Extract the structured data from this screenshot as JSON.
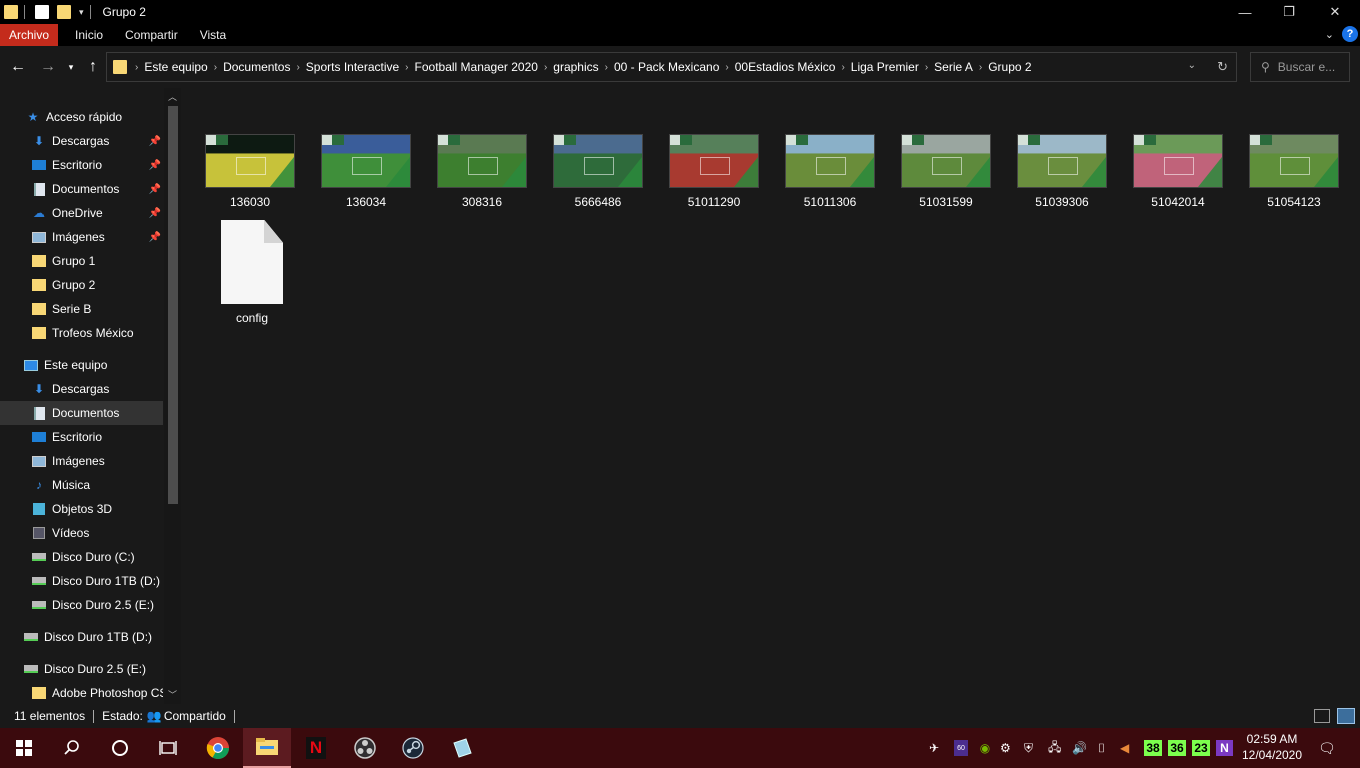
{
  "window": {
    "title": "Grupo 2",
    "minimize": "—",
    "maximize": "❐",
    "close": "✕"
  },
  "ribbon": {
    "tabs": [
      "Archivo",
      "Inicio",
      "Compartir",
      "Vista"
    ],
    "active_tab": "Archivo",
    "help": "?"
  },
  "address": {
    "crumbs": [
      "Este equipo",
      "Documentos",
      "Sports Interactive",
      "Football Manager 2020",
      "graphics",
      "00 - Pack Mexicano",
      "00Estadios México",
      "Liga Premier",
      "Serie A",
      "Grupo 2"
    ],
    "search_placeholder": "Buscar e..."
  },
  "sidebar": {
    "quick_access": {
      "label": "Acceso rápido"
    },
    "quick_items": [
      {
        "label": "Descargas",
        "icon": "download-icon",
        "pinned": true
      },
      {
        "label": "Escritorio",
        "icon": "desktop-icon",
        "pinned": true
      },
      {
        "label": "Documentos",
        "icon": "documents-icon",
        "pinned": true
      },
      {
        "label": "OneDrive",
        "icon": "onedrive-icon",
        "pinned": true
      },
      {
        "label": "Imágenes",
        "icon": "pictures-icon",
        "pinned": true
      },
      {
        "label": "Grupo 1",
        "icon": "folder-icon"
      },
      {
        "label": "Grupo 2",
        "icon": "folder-icon"
      },
      {
        "label": "Serie B",
        "icon": "folder-icon"
      },
      {
        "label": "Trofeos México",
        "icon": "folder-icon"
      }
    ],
    "this_pc": {
      "label": "Este equipo"
    },
    "pc_items": [
      {
        "label": "Descargas",
        "icon": "download-icon"
      },
      {
        "label": "Documentos",
        "icon": "documents-icon",
        "selected": true
      },
      {
        "label": "Escritorio",
        "icon": "desktop-icon"
      },
      {
        "label": "Imágenes",
        "icon": "pictures-icon"
      },
      {
        "label": "Música",
        "icon": "music-icon"
      },
      {
        "label": "Objetos 3D",
        "icon": "3d-objects-icon"
      },
      {
        "label": "Vídeos",
        "icon": "videos-icon"
      },
      {
        "label": "Disco Duro (C:)",
        "icon": "drive-icon"
      },
      {
        "label": "Disco Duro 1TB (D:)",
        "icon": "drive-icon"
      },
      {
        "label": "Disco Duro 2.5 (E:)",
        "icon": "drive-icon"
      }
    ],
    "drives": [
      {
        "label": "Disco Duro 1TB (D:)",
        "icon": "drive-icon"
      },
      {
        "label": "Disco Duro 2.5 (E:)",
        "icon": "drive-icon"
      }
    ],
    "last_item": {
      "label": "Adobe Photoshop CS",
      "icon": "folder-icon"
    }
  },
  "files": [
    {
      "name": "136030",
      "kind": "image",
      "pitch": "#c7c23a",
      "sky": "#0d1a12"
    },
    {
      "name": "136034",
      "kind": "image",
      "pitch": "#3f8f3a",
      "sky": "#3a5d9a"
    },
    {
      "name": "308316",
      "kind": "image",
      "pitch": "#3d7f2f",
      "sky": "#5a7a52"
    },
    {
      "name": "5666486",
      "kind": "image",
      "pitch": "#2e6b3a",
      "sky": "#4b6b8f"
    },
    {
      "name": "51011290",
      "kind": "image",
      "pitch": "#a83a30",
      "sky": "#56805a"
    },
    {
      "name": "51011306",
      "kind": "image",
      "pitch": "#6a8d3a",
      "sky": "#8ab0c8"
    },
    {
      "name": "51031599",
      "kind": "image",
      "pitch": "#5e8a3c",
      "sky": "#9aa6a0"
    },
    {
      "name": "51039306",
      "kind": "image",
      "pitch": "#6a8e3e",
      "sky": "#9cb8c8"
    },
    {
      "name": "51042014",
      "kind": "image",
      "pitch": "#c0637a",
      "sky": "#6b9a58"
    },
    {
      "name": "51054123",
      "kind": "image",
      "pitch": "#5f8f3a",
      "sky": "#6e8a60"
    },
    {
      "name": "config",
      "kind": "document"
    }
  ],
  "status": {
    "count": "11 elementos",
    "state_label": "Estado:",
    "state_value": "Compartido"
  },
  "taskbar": {
    "apps": [
      "start-icon",
      "search-icon",
      "cortana-icon",
      "task-view-icon",
      "chrome-icon",
      "file-explorer-icon",
      "netflix-icon",
      "obs-icon",
      "steam-icon",
      "notes-icon"
    ],
    "temps": [
      "38",
      "36",
      "23"
    ],
    "onenote": "N",
    "time": "02:59 AM",
    "date": "12/04/2020"
  },
  "colors": {
    "accent": "#c42b1c",
    "taskbar": "#3b0a0d",
    "folder": "#f8d775"
  }
}
